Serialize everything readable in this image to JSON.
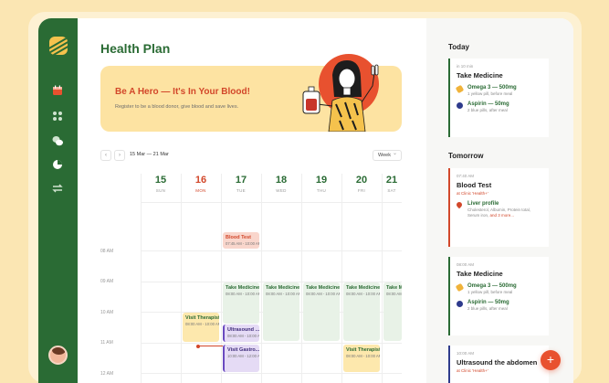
{
  "app": {
    "title": "Health Plan"
  },
  "banner": {
    "title": "Be A Hero — It's In Your Blood!",
    "subtitle": "Register to be a blood donor, give blood and save lives."
  },
  "calendar": {
    "date_range": "15 Mar — 21 Mar",
    "view": "Week",
    "prev_icon": "chevron-left-icon",
    "next_icon": "chevron-right-icon",
    "days": [
      {
        "num": "15",
        "weekday": "SUN"
      },
      {
        "num": "16",
        "weekday": "MON"
      },
      {
        "num": "17",
        "weekday": "TUE"
      },
      {
        "num": "18",
        "weekday": "WED"
      },
      {
        "num": "19",
        "weekday": "THU"
      },
      {
        "num": "20",
        "weekday": "FRI"
      },
      {
        "num": "21",
        "weekday": "SAT"
      }
    ],
    "times": [
      "08 AM",
      "09 AM",
      "10 AM",
      "11 AM",
      "12 AM"
    ],
    "events": {
      "blood_test": {
        "title": "Blood Test",
        "time": "07:45 AM - 10:00 AM"
      },
      "take_medicine": {
        "title": "Take Medicine",
        "time": "08:00 AM - 10:00 AM"
      },
      "visit_therapist_sun": {
        "title": "Visit Therapist",
        "time": "08:00 AM - 10:00 AM"
      },
      "visit_therapist_fri": {
        "title": "Visit Therapist",
        "time": "08:00 AM - 10:00 AM"
      },
      "ultrasound": {
        "title": "Ultrasound ...",
        "time": "08:00 AM - 10:00 AM"
      },
      "visit_gastro": {
        "title": "Visit Gastro...",
        "time": "10:00 AM - 12:00 AM"
      }
    }
  },
  "agenda": {
    "today_label": "Today",
    "tomorrow_label": "Tomorrow",
    "today_card": {
      "time": "in 10 min",
      "title": "Take Medicine",
      "meds": [
        {
          "name": "Omega 3 — 500mg",
          "desc": "1 yellow pill, before meal",
          "color": "#f0b33a"
        },
        {
          "name": "Aspirin — 50mg",
          "desc": "2 blue pills, after meal",
          "color": "#2e3b8c"
        }
      ]
    },
    "blood_test_card": {
      "time": "07:40 AM",
      "title": "Blood Test",
      "location": "at Clinic 'Health+'",
      "lab": {
        "name": "Liver profile",
        "desc": "Cholesterol, Albumin, Protein total, Serum iron,",
        "more": "and 3 more...",
        "color": "#d2472a"
      }
    },
    "medicine_card": {
      "time": "08:00 AM",
      "title": "Take Medicine",
      "meds": [
        {
          "name": "Omega 3 — 500mg",
          "desc": "1 yellow pill, before meal",
          "color": "#f0b33a"
        },
        {
          "name": "Aspirin — 50mg",
          "desc": "2 blue pills, after meal",
          "color": "#2e3b8c"
        }
      ]
    },
    "ultrasound_card": {
      "time": "10:00 AM",
      "title": "Ultrasound the abdomen",
      "location": "at Clinic 'Health+'"
    }
  },
  "fab_label": "+",
  "colors": {
    "brand_green": "#2a6b34",
    "accent_red": "#d2472a",
    "banner_yellow": "#fde3a2",
    "event_green": "#e8f2e7",
    "event_purple": "#e5dbf5"
  }
}
